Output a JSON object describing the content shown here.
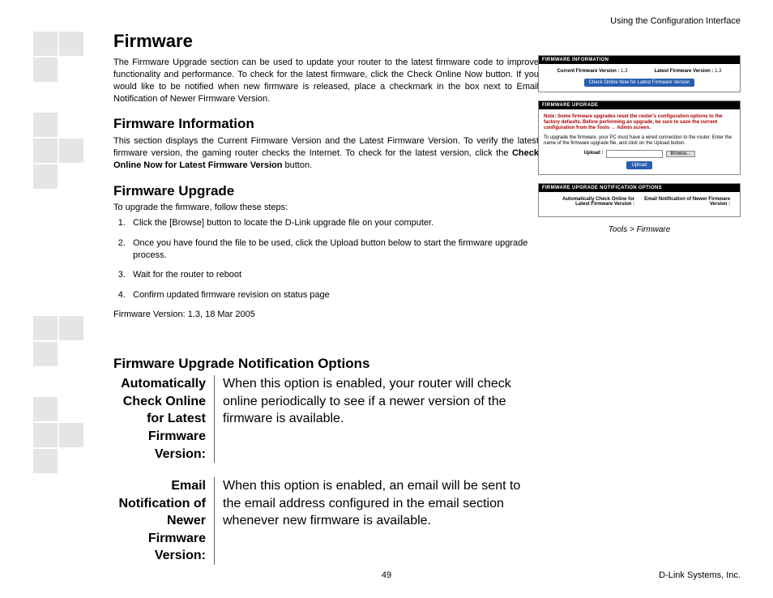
{
  "header": {
    "right": "Using the Configuration Interface"
  },
  "h1": "Firmware",
  "intro": "The Firmware Upgrade section can be used to update your router to the latest firmware code to improve functionality and performance. To check for the latest firmware, click the Check Online Now button. If you would like to be notified when new firmware is released, place a checkmark in the box next to Email Notification of Newer Firmware Version.",
  "h2_info": "Firmware Information",
  "info_para_pre": "This section displays the Current Firmware Version and the Latest Firmware Version. To verify the latest firmware version, the gaming router checks the Internet. To check for the latest version, click the ",
  "info_para_strong": "Check Online Now for Latest Firmware Version",
  "info_para_post": " button.",
  "h2_upgrade": "Firmware Upgrade",
  "steps_intro": "To upgrade the firmware, follow these steps:",
  "steps": [
    "Click the [Browse] button to locate the D-Link upgrade file on your computer.",
    "Once you have found the file to be used, click the Upload button below to start the firmware upgrade process.",
    "Wait for the router to reboot",
    "Confirm updated firmware revision on status page"
  ],
  "fw_version_line": "Firmware Version: 1.3, 18 Mar 2005",
  "h2_options": "Firmware Upgrade Notification Options",
  "options": [
    {
      "label": "Automatically Check Online for Latest Firmware Version:",
      "desc": "When this option is enabled, your router will check online periodically to see if a newer version of the firmware is available."
    },
    {
      "label": "Email Notification of Newer Firmware Version:",
      "desc": "When this option is enabled, an email will be sent to the email address configured in the email section whenever new firmware is available."
    }
  ],
  "shot": {
    "p1_header": "FIRMWARE INFORMATION",
    "p1_cur_label": "Current Firmware Version :",
    "p1_cur_val": "1.3",
    "p1_lat_label": "Latest Firmware Version :",
    "p1_lat_val": "1.3",
    "p1_button": "Check Online Now for Latest Firmware Version",
    "p2_header": "FIRMWARE UPGRADE",
    "p2_note": "Note: Some firmware upgrades reset the router's configuration options to the factory defaults. Before performing an upgrade, be sure to save the current configuration from the Tools → Admin screen.",
    "p2_text": "To upgrade the firmware, your PC must have a wired connection to the router. Enter the name of the firmware upgrade file, and click on the Upload button.",
    "p2_upload_label": "Upload :",
    "p2_browse": "Browse...",
    "p2_upload_btn": "Upload",
    "p3_header": "FIRMWARE UPGRADE NOTIFICATION OPTIONS",
    "p3_left": "Automatically Check Online for Latest Firmware Version :",
    "p3_right": "Email Notification of Newer Firmware Version :",
    "caption": "Tools > Firmware"
  },
  "footer": {
    "page": "49",
    "company": "D-Link Systems, Inc."
  }
}
